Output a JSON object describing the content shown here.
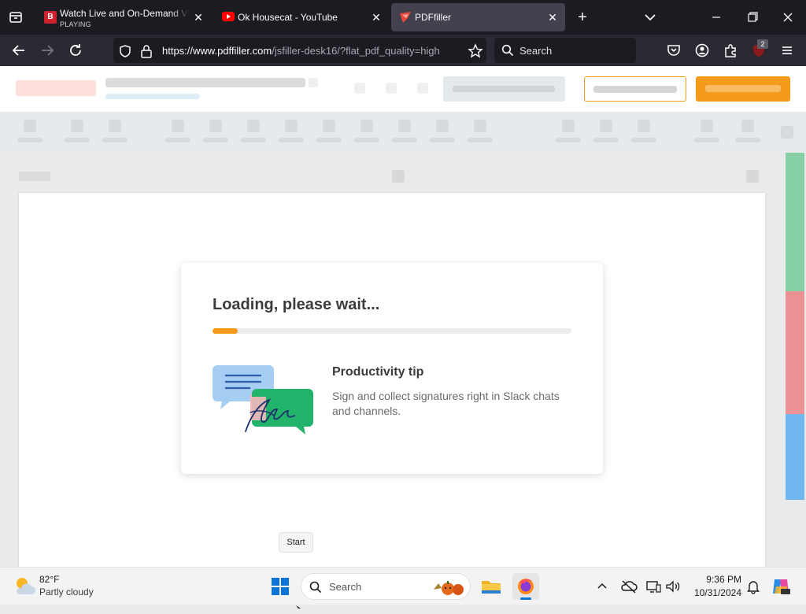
{
  "browser": {
    "tabs": [
      {
        "title": "Watch Live and On-Demand Vi",
        "subtitle": "PLAYING",
        "icon": "cbs-news-icon",
        "active": false
      },
      {
        "title": "Ok Housecat - YouTube",
        "icon": "youtube-icon",
        "active": false
      },
      {
        "title": "PDFfiller",
        "icon": "pdffiller-icon",
        "active": true
      }
    ],
    "url_domain": "https://www.pdffiller.com",
    "url_path": "/jsfiller-desk16/?flat_pdf_quality=high",
    "search_placeholder": "Search",
    "extension_badge": "2"
  },
  "loader": {
    "title": "Loading, please wait...",
    "progress": 0.07,
    "tip_heading": "Productivity tip",
    "tip_text": "Sign and collect signatures right in Slack chats and channels."
  },
  "tooltip": {
    "label": "Start"
  },
  "taskbar": {
    "weather_temp": "82°F",
    "weather_desc": "Partly cloudy",
    "search_label": "Search",
    "time": "9:36 PM",
    "date": "10/31/2024"
  },
  "colors": {
    "accent_orange": "#f59a1b",
    "side_green": "#86d0a8",
    "side_red": "#ec9294",
    "side_blue": "#6fb7ee"
  }
}
